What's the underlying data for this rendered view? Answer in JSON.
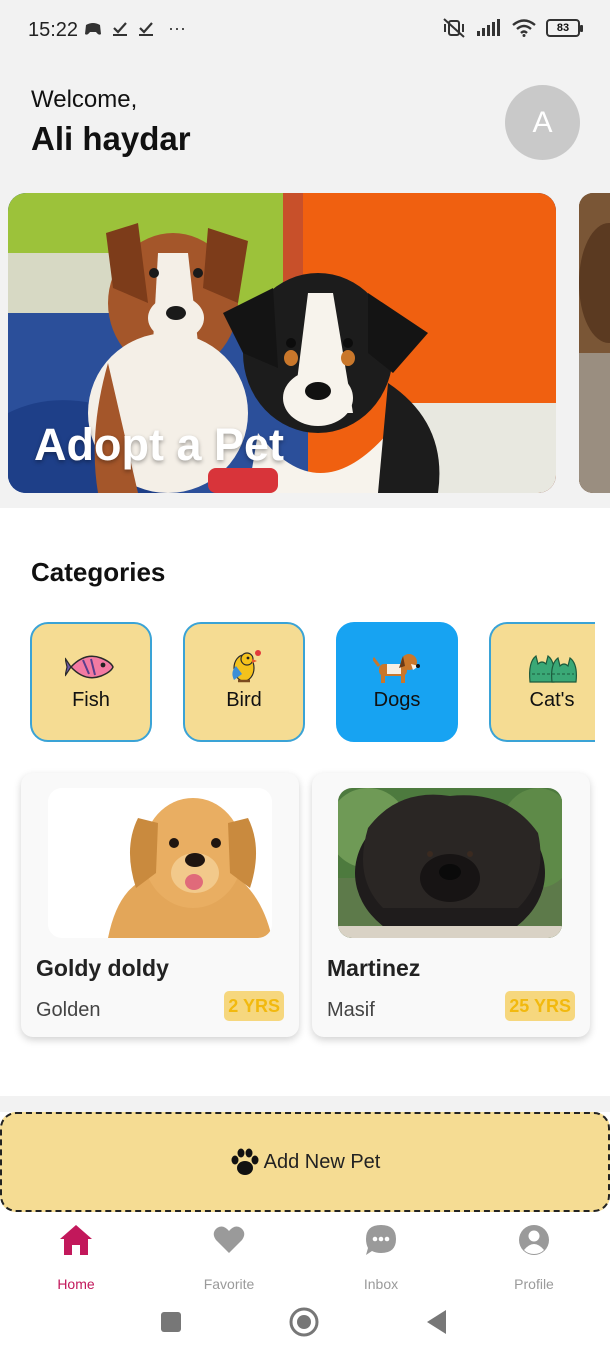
{
  "status": {
    "time": "15:22",
    "battery": "83",
    "more": "···"
  },
  "header": {
    "greeting": "Welcome,",
    "user_name": "Ali haydar",
    "avatar_letter": "A"
  },
  "banner": {
    "title": "Adopt a Pet"
  },
  "categories": {
    "title": "Categories",
    "items": [
      {
        "label": "Fish",
        "icon": "fish-icon",
        "active": false
      },
      {
        "label": "Bird",
        "icon": "bird-icon",
        "active": false
      },
      {
        "label": "Dogs",
        "icon": "dog-icon",
        "active": true
      },
      {
        "label": "Cat's",
        "icon": "cat-icon",
        "active": false
      }
    ]
  },
  "pets": [
    {
      "name": "Goldy doldy",
      "breed": "Golden",
      "age": "2 YRS"
    },
    {
      "name": "Martinez",
      "breed": "Masif",
      "age": "25 YRS"
    }
  ],
  "add_pet": {
    "label": "Add New Pet",
    "icon": "paw-icon"
  },
  "bottom_nav": {
    "items": [
      {
        "label": "Home",
        "icon": "home-icon",
        "active": true
      },
      {
        "label": "Favorite",
        "icon": "heart-icon",
        "active": false
      },
      {
        "label": "Inbox",
        "icon": "chat-icon",
        "active": false
      },
      {
        "label": "Profile",
        "icon": "profile-icon",
        "active": false
      }
    ]
  },
  "colors": {
    "accent": "#c2185b",
    "category_bg": "#f5dc93",
    "category_active": "#17a3f2",
    "badge_text": "#f2b90e"
  }
}
